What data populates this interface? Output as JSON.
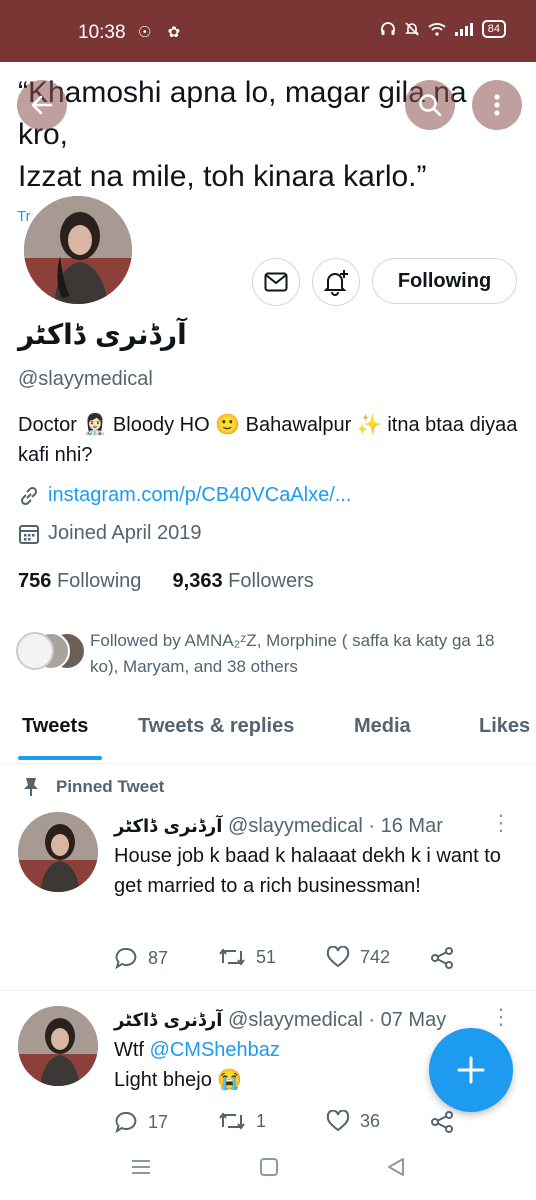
{
  "status_bar": {
    "time": "10:38",
    "left_icons": [
      "snapchat-icon",
      "twitter-icon"
    ],
    "right_icons": [
      "headphones-icon",
      "bell-off-icon",
      "wifi-icon",
      "signal-icon"
    ],
    "battery": "84"
  },
  "banner": {
    "quote": "“Khamoshi apna lo, magar gila na kro,\nIzzat na mile, toh kinara karlo.”",
    "translate_label": "Translate Tweet"
  },
  "header_buttons": {
    "back": "back-arrow-icon",
    "search": "search-icon",
    "more": "more-vertical-icon"
  },
  "profile": {
    "name": "آرڈنری ڈاکٹر",
    "handle": "@slayymedical",
    "bio_parts": [
      "Doctor ",
      "👩🏻‍⚕️",
      " Bloody HO ",
      "🙂",
      " Bahawalpur ",
      "✨",
      " itna btaa diyaa kafi nhi?"
    ],
    "link": "instagram.com/p/CB40VCaAlxe/...",
    "joined": "Joined April 2019",
    "following_count": "756",
    "following_label": "Following",
    "followers_count": "9,363",
    "followers_label": "Followers",
    "followed_by": "Followed by AMNA₂ᶻZ, Morphine ( saffa ka katy ga 18 ko), Maryam, and 38 others",
    "follow_button": "Following"
  },
  "tabs": [
    "Tweets",
    "Tweets & replies",
    "Media",
    "Likes"
  ],
  "pinned_label": "Pinned Tweet",
  "tweets": [
    {
      "name": "آرڈنری ڈاکٹر",
      "handle": "@slayymedical",
      "date": "16 Mar",
      "text": "House job k baad k halaaat dekh k i want to get married to a rich businessman!",
      "replies": "87",
      "retweets": "51",
      "likes": "742"
    },
    {
      "name": "آرڈنری ڈاکٹر",
      "handle": "@slayymedical",
      "date": "07 May",
      "text_prefix": "Wtf ",
      "mention": "@CMShehbaz",
      "text_line2": "Light bhejo ",
      "emoji": "😭",
      "replies": "17",
      "retweets": "1",
      "likes": "36"
    }
  ],
  "colors": {
    "accent": "#1d9bf0",
    "status_bar": "#7a3535",
    "muted": "#536471"
  }
}
